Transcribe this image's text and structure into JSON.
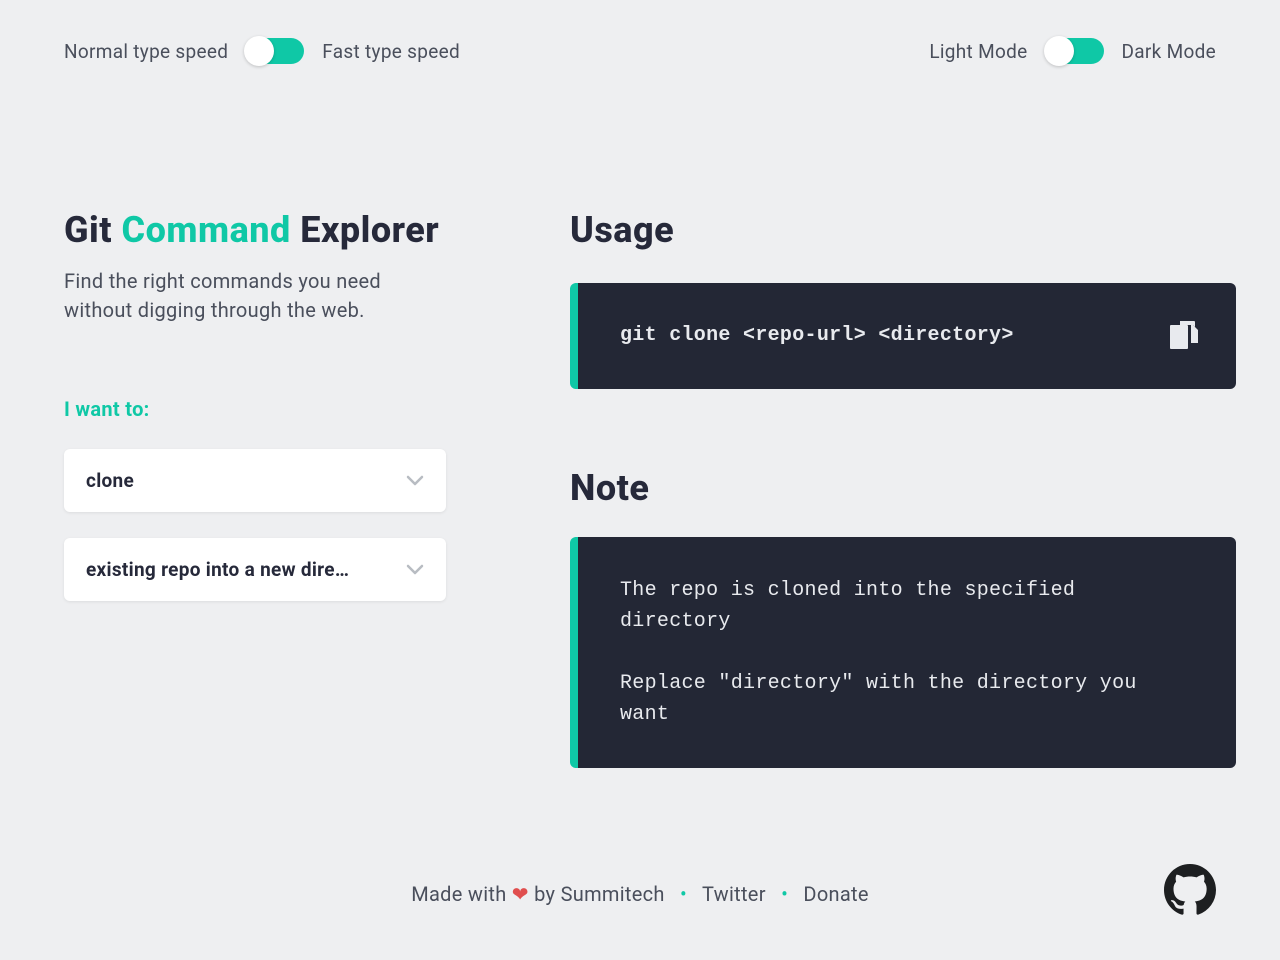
{
  "header": {
    "speed": {
      "normal": "Normal type speed",
      "fast": "Fast type speed"
    },
    "mode": {
      "light": "Light Mode",
      "dark": "Dark Mode"
    }
  },
  "title": {
    "pre": "Git ",
    "accent": "Command",
    "post": " Explorer"
  },
  "subtitle": "Find the right commands you need without digging through the web.",
  "prompt": "I want to:",
  "dropdown1": "clone",
  "dropdown2": "existing repo into a new dire…",
  "usage": {
    "heading": "Usage",
    "command": "git clone <repo-url> <directory>"
  },
  "note": {
    "heading": "Note",
    "body": "The repo is cloned into the specified directory\n\nReplace \"directory\" with the directory you want"
  },
  "footer": {
    "made_pre": "Made with ",
    "made_post": " by Summitech",
    "twitter": "Twitter",
    "donate": "Donate"
  },
  "colors": {
    "accent": "#0fc8a6",
    "code_bg": "#232735"
  }
}
